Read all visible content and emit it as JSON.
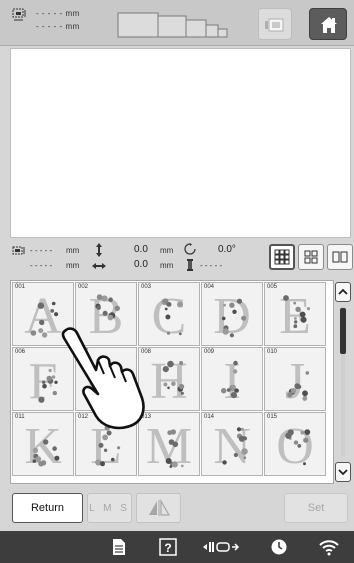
{
  "top": {
    "width_value": "- - - - -",
    "width_unit": "mm",
    "height_value": "- - - - -",
    "height_unit": "mm"
  },
  "info": {
    "w_value": "- - - - -",
    "w_unit": "mm",
    "h_value": "- - - - -",
    "h_unit": "mm",
    "move_y": "0.0",
    "move_y_unit": "mm",
    "move_x": "0.0",
    "move_x_unit": "mm",
    "rotation": "0.0°",
    "color_count": "- - - - -"
  },
  "patterns": [
    {
      "num": "001",
      "letter": "A"
    },
    {
      "num": "002",
      "letter": "B"
    },
    {
      "num": "003",
      "letter": "C"
    },
    {
      "num": "004",
      "letter": "D"
    },
    {
      "num": "005",
      "letter": "E"
    },
    {
      "num": "006",
      "letter": "F"
    },
    {
      "num": "007",
      "letter": "G"
    },
    {
      "num": "008",
      "letter": "H"
    },
    {
      "num": "009",
      "letter": "I"
    },
    {
      "num": "010",
      "letter": "J"
    },
    {
      "num": "011",
      "letter": "K"
    },
    {
      "num": "012",
      "letter": "L"
    },
    {
      "num": "013",
      "letter": "M"
    },
    {
      "num": "014",
      "letter": "N"
    },
    {
      "num": "015",
      "letter": "O"
    }
  ],
  "buttons": {
    "return": "Return",
    "lms": "L M S",
    "set": "Set"
  },
  "icons": {
    "size": "embroidery-size-icon",
    "frames": "frame-sizes-icon",
    "frame_move": "frame-move-icon",
    "home": "home-icon",
    "rotate": "rotate-icon",
    "thread": "thread-count-icon",
    "mirror": "mirror-icon",
    "scroll_up": "chevron-up-icon",
    "scroll_down": "chevron-down-icon",
    "document": "document-icon",
    "help": "help-icon",
    "presser": "presser-foot-icon",
    "clock": "clock-icon",
    "wifi": "wifi-icon",
    "hand": "hand-pointer-icon"
  }
}
